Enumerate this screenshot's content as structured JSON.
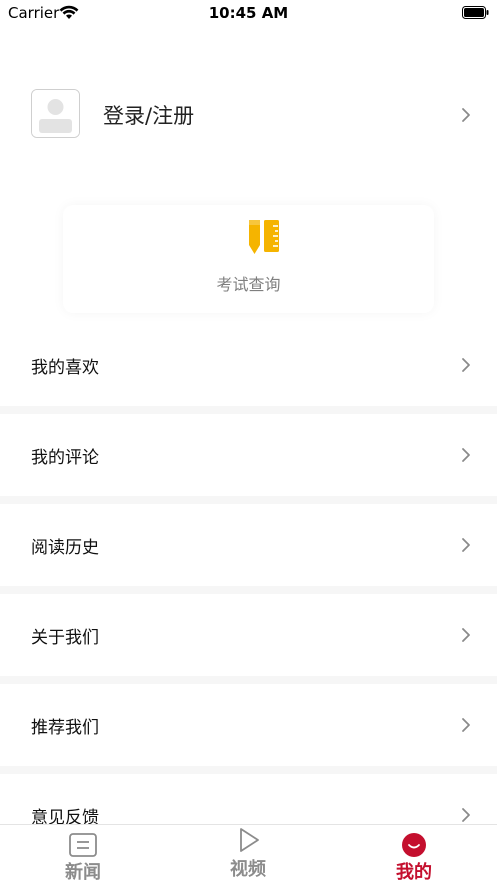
{
  "status_bar": {
    "carrier": "Carrier",
    "time": "10:45 AM"
  },
  "profile": {
    "login_label": "登录/注册"
  },
  "tools": [
    {
      "label": "考试查询",
      "icon": "pencil-ruler-icon"
    }
  ],
  "menu": [
    {
      "label": "我的喜欢"
    },
    {
      "label": "我的评论"
    },
    {
      "label": "阅读历史"
    },
    {
      "label": "关于我们"
    },
    {
      "label": "推荐我们"
    },
    {
      "label": "意见反馈"
    }
  ],
  "tab_bar": {
    "tabs": [
      {
        "label": "新闻",
        "icon": "news-icon",
        "active": false
      },
      {
        "label": "视频",
        "icon": "play-icon",
        "active": false
      },
      {
        "label": "我的",
        "icon": "smile-icon",
        "active": true
      }
    ]
  },
  "colors": {
    "accent": "#c40f2e",
    "tool_icon_yellow": "#f5b400",
    "inactive_tab": "#8c8c8c",
    "divider": "#f6f6f6"
  }
}
